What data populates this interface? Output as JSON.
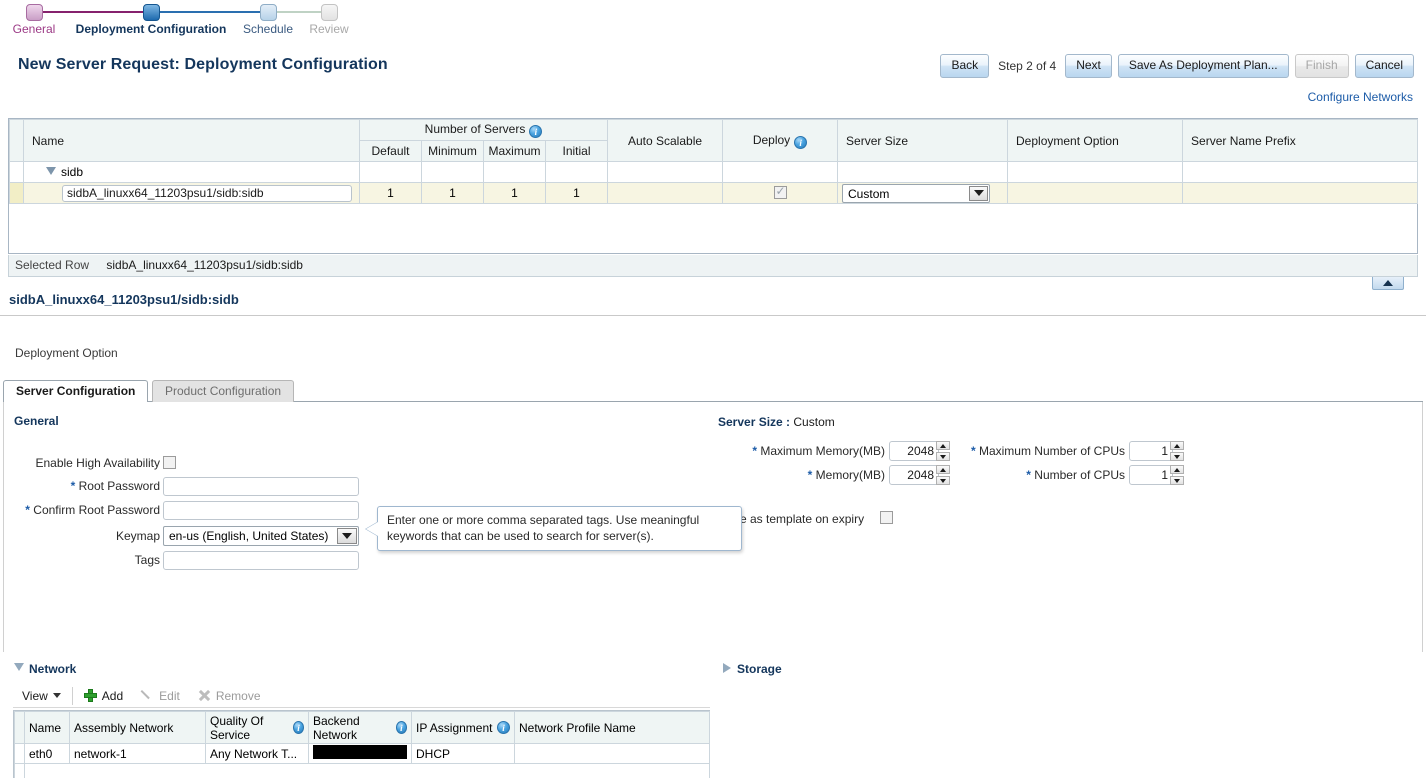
{
  "train": {
    "steps": [
      {
        "label": "General",
        "state": "done"
      },
      {
        "label": "Deployment Configuration",
        "state": "current"
      },
      {
        "label": "Schedule",
        "state": "next"
      },
      {
        "label": "Review",
        "state": "disabled"
      }
    ]
  },
  "header": {
    "title": "New Server Request: Deployment Configuration",
    "step_text": "Step 2 of 4",
    "buttons": {
      "back": "Back",
      "next": "Next",
      "save_as_plan": "Save As Deployment Plan...",
      "finish": "Finish",
      "cancel": "Cancel"
    },
    "configure_networks": "Configure Networks"
  },
  "master_table": {
    "headers": {
      "name": "Name",
      "number_of_servers": "Number of Servers",
      "default": "Default",
      "minimum": "Minimum",
      "maximum": "Maximum",
      "initial": "Initial",
      "auto_scalable": "Auto Scalable",
      "deploy": "Deploy",
      "server_size": "Server Size",
      "deployment_option": "Deployment Option",
      "server_name_prefix": "Server Name Prefix"
    },
    "rows": [
      {
        "type": "group",
        "name": "sidb",
        "default": "",
        "minimum": "",
        "maximum": "",
        "initial": "",
        "auto_scalable": "",
        "server_size": "",
        "deployment_option": "",
        "server_name_prefix": ""
      },
      {
        "type": "leaf",
        "name": "sidbA_linuxx64_11203psu1/sidb:sidb",
        "default": "1",
        "minimum": "1",
        "maximum": "1",
        "initial": "1",
        "auto_scalable": "",
        "deploy_checked": true,
        "server_size": "Custom",
        "deployment_option": "",
        "server_name_prefix": ""
      }
    ]
  },
  "selected_row": {
    "label": "Selected Row",
    "value": "sidbA_linuxx64_11203psu1/sidb:sidb"
  },
  "detail": {
    "title": "sidbA_linuxx64_11203psu1/sidb:sidb",
    "deployment_option_label": "Deployment Option"
  },
  "tabs": [
    {
      "label": "Server Configuration",
      "active": true
    },
    {
      "label": "Product Configuration",
      "active": false
    }
  ],
  "general": {
    "heading": "General",
    "enable_ha_label": "Enable High Availability",
    "enable_ha_checked": false,
    "root_password_label": "Root Password",
    "root_password_value": "",
    "confirm_root_password_label": "Confirm Root Password",
    "confirm_root_password_value": "",
    "keymap_label": "Keymap",
    "keymap_value": "en-us (English, United States)",
    "tags_label": "Tags",
    "tags_value": "",
    "required_marker": "*"
  },
  "server_size": {
    "label": "Server Size :",
    "value": "Custom",
    "max_memory_label": "Maximum Memory(MB)",
    "max_memory_value": "2048",
    "memory_label": "Memory(MB)",
    "memory_value": "2048",
    "max_cpus_label": "Maximum Number of CPUs",
    "max_cpus_value": "1",
    "cpus_label": "Number of CPUs",
    "cpus_value": "1",
    "template_on_expiry_label": "e as template on expiry",
    "template_on_expiry_checked": false
  },
  "tooltip": {
    "text": "Enter one or more comma separated tags. Use meaningful keywords that can be used to search for server(s)."
  },
  "network": {
    "heading": "Network",
    "toolbar": {
      "view": "View",
      "add": "Add",
      "edit": "Edit",
      "remove": "Remove"
    },
    "headers": {
      "name": "Name",
      "assembly_network": "Assembly Network",
      "quality_of_service": "Quality Of Service",
      "backend_network": "Backend Network",
      "ip_assignment": "IP Assignment",
      "network_profile_name": "Network Profile Name"
    },
    "rows": [
      {
        "name": "eth0",
        "assembly_network": "network-1",
        "quality_of_service": "Any Network T...",
        "backend_network": "",
        "backend_network_redacted": true,
        "ip_assignment": "DHCP",
        "network_profile_name": ""
      }
    ]
  },
  "storage": {
    "heading": "Storage"
  },
  "colors": {
    "train_done": "#9c3a86",
    "train_current": "#2a6fb0",
    "train_next": "#9fc0dc",
    "train_disabled": "#d8d8d8",
    "title_blue": "#14365c",
    "link_blue": "#1d5ca8",
    "header_bg": "#eff5f4",
    "selected_row_bg": "#f7f5e2"
  }
}
